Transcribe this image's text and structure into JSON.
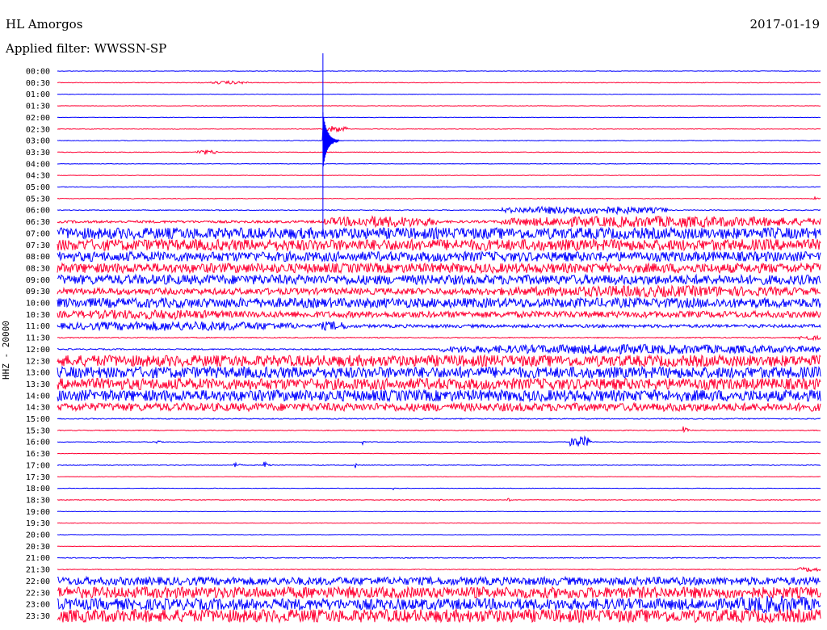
{
  "header": {
    "station": "HL Amorgos",
    "date": "2017-01-19",
    "filter": "Applied filter: WWSSN-SP"
  },
  "axis": {
    "ylabel": "HHZ - 20000"
  },
  "colors": {
    "even": "#0000ff",
    "odd": "#ff0033",
    "marker": "#0000ff"
  },
  "chart_data": {
    "type": "line",
    "title": "",
    "ylabel": "HHZ - 20000",
    "y_tick_labels": [
      "00:00",
      "00:30",
      "01:00",
      "01:30",
      "02:00",
      "02:30",
      "03:00",
      "03:30",
      "04:00",
      "04:30",
      "05:00",
      "05:30",
      "06:00",
      "06:30",
      "07:00",
      "07:30",
      "08:00",
      "08:30",
      "09:00",
      "09:30",
      "10:00",
      "10:30",
      "11:00",
      "11:30",
      "12:00",
      "12:30",
      "13:00",
      "13:30",
      "14:00",
      "14:30",
      "15:00",
      "15:30",
      "16:00",
      "16:30",
      "17:00",
      "17:30",
      "18:00",
      "18:30",
      "19:00",
      "19:30",
      "20:00",
      "20:30",
      "21:00",
      "21:30",
      "22:00",
      "22:30",
      "23:00",
      "23:30"
    ],
    "x_range_minutes": [
      0,
      30
    ],
    "series_colors_alternate": [
      "blue",
      "red"
    ],
    "traces": [
      {
        "label": "00:00",
        "noise": 0.3,
        "bursts": []
      },
      {
        "label": "00:30",
        "noise": 0.4,
        "bursts": [
          [
            0.2,
            0.05,
            2
          ]
        ]
      },
      {
        "label": "01:00",
        "noise": 0.3,
        "bursts": []
      },
      {
        "label": "01:30",
        "noise": 0.3,
        "bursts": []
      },
      {
        "label": "02:00",
        "noise": 0.3,
        "bursts": []
      },
      {
        "label": "02:30",
        "noise": 0.4,
        "bursts": [
          [
            0.35,
            0.03,
            4
          ]
        ]
      },
      {
        "label": "03:00",
        "noise": 0.4,
        "bursts": [
          [
            0.348,
            0.02,
            30
          ]
        ]
      },
      {
        "label": "03:30",
        "noise": 0.4,
        "bursts": [
          [
            0.18,
            0.03,
            3
          ]
        ]
      },
      {
        "label": "04:00",
        "noise": 0.3,
        "bursts": []
      },
      {
        "label": "04:30",
        "noise": 0.3,
        "bursts": []
      },
      {
        "label": "05:00",
        "noise": 0.4,
        "bursts": []
      },
      {
        "label": "05:30",
        "noise": 0.4,
        "bursts": [
          [
            0.99,
            0.02,
            3
          ]
        ]
      },
      {
        "label": "06:00",
        "noise": 0.5,
        "bursts": [
          [
            0.21,
            0.01,
            3
          ],
          [
            0.58,
            0.22,
            5
          ]
        ]
      },
      {
        "label": "06:30",
        "noise": 1.5,
        "bursts": [
          [
            0.35,
            0.15,
            7
          ],
          [
            0.58,
            0.42,
            7
          ]
        ]
      },
      {
        "label": "07:00",
        "noise": 7,
        "bursts": []
      },
      {
        "label": "07:30",
        "noise": 7,
        "bursts": []
      },
      {
        "label": "08:00",
        "noise": 6,
        "bursts": []
      },
      {
        "label": "08:30",
        "noise": 6,
        "bursts": []
      },
      {
        "label": "09:00",
        "noise": 6,
        "bursts": []
      },
      {
        "label": "09:30",
        "noise": 4,
        "bursts": [
          [
            0.55,
            0.45,
            7
          ]
        ]
      },
      {
        "label": "10:00",
        "noise": 6,
        "bursts": []
      },
      {
        "label": "10:30",
        "noise": 4,
        "bursts": [
          [
            0.0,
            0.25,
            6
          ]
        ]
      },
      {
        "label": "11:00",
        "noise": 2,
        "bursts": [
          [
            0.0,
            0.32,
            6
          ],
          [
            0.34,
            0.04,
            6
          ]
        ]
      },
      {
        "label": "11:30",
        "noise": 0.6,
        "bursts": [
          [
            0.97,
            0.03,
            3
          ]
        ]
      },
      {
        "label": "12:00",
        "noise": 0.8,
        "bursts": [
          [
            0.5,
            0.5,
            6
          ]
        ]
      },
      {
        "label": "12:30",
        "noise": 7,
        "bursts": []
      },
      {
        "label": "13:00",
        "noise": 7,
        "bursts": []
      },
      {
        "label": "13:30",
        "noise": 7,
        "bursts": []
      },
      {
        "label": "14:00",
        "noise": 7,
        "bursts": []
      },
      {
        "label": "14:30",
        "noise": 5,
        "bursts": []
      },
      {
        "label": "15:00",
        "noise": 0.6,
        "bursts": []
      },
      {
        "label": "15:30",
        "noise": 0.5,
        "bursts": [
          [
            0.82,
            0.02,
            5
          ]
        ]
      },
      {
        "label": "16:00",
        "noise": 0.4,
        "bursts": [
          [
            0.13,
            0.01,
            5
          ],
          [
            0.4,
            0.005,
            5
          ],
          [
            0.67,
            0.03,
            7
          ]
        ]
      },
      {
        "label": "16:30",
        "noise": 0.3,
        "bursts": []
      },
      {
        "label": "17:00",
        "noise": 0.4,
        "bursts": [
          [
            0.23,
            0.02,
            5
          ],
          [
            0.27,
            0.02,
            7
          ],
          [
            0.39,
            0.005,
            6
          ]
        ]
      },
      {
        "label": "17:30",
        "noise": 0.3,
        "bursts": []
      },
      {
        "label": "18:00",
        "noise": 0.3,
        "bursts": [
          [
            0.44,
            0.005,
            3
          ]
        ]
      },
      {
        "label": "18:30",
        "noise": 0.4,
        "bursts": [
          [
            0.5,
            0.01,
            3
          ],
          [
            0.59,
            0.01,
            3
          ]
        ]
      },
      {
        "label": "19:00",
        "noise": 0.3,
        "bursts": []
      },
      {
        "label": "19:30",
        "noise": 0.3,
        "bursts": []
      },
      {
        "label": "20:00",
        "noise": 0.3,
        "bursts": []
      },
      {
        "label": "20:30",
        "noise": 0.3,
        "bursts": []
      },
      {
        "label": "21:00",
        "noise": 0.5,
        "bursts": []
      },
      {
        "label": "21:30",
        "noise": 0.5,
        "bursts": [
          [
            0.97,
            0.03,
            3
          ]
        ]
      },
      {
        "label": "22:00",
        "noise": 5,
        "bursts": []
      },
      {
        "label": "22:30",
        "noise": 7,
        "bursts": []
      },
      {
        "label": "23:00",
        "noise": 7,
        "bursts": [
          [
            0.88,
            0.12,
            11
          ]
        ]
      },
      {
        "label": "23:30",
        "noise": 8,
        "bursts": []
      }
    ],
    "event_marker_fraction": 0.348
  }
}
